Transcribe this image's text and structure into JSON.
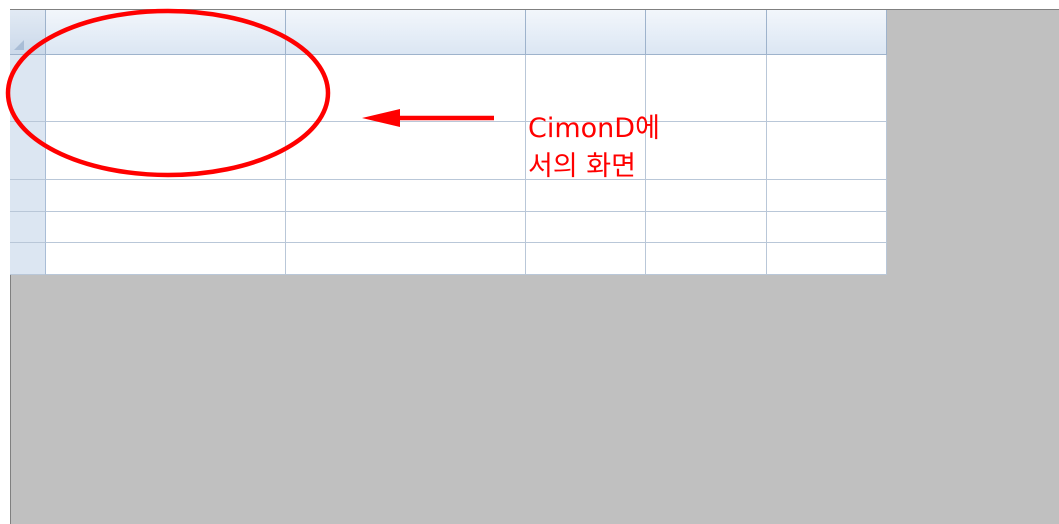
{
  "annotation": {
    "line1": "CimonD에",
    "line2": "서의 화면",
    "color": "#ff0000"
  },
  "grid": {
    "header": [
      "",
      "",
      "",
      "",
      ""
    ],
    "rows": [
      [
        "",
        "",
        "",
        "",
        ""
      ],
      [
        "",
        "",
        "",
        "",
        ""
      ],
      [
        "",
        "",
        "",
        "",
        ""
      ],
      [
        "",
        "",
        "",
        "",
        ""
      ],
      [
        "",
        "",
        "",
        "",
        ""
      ]
    ]
  },
  "colors": {
    "background": "#c0c0c0",
    "header": "#dbe6f3",
    "gridline": "#b9c7d8"
  }
}
